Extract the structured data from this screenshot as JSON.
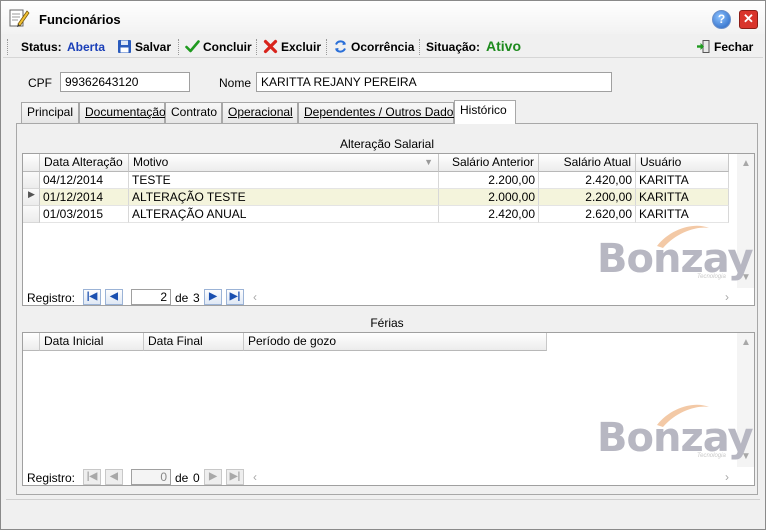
{
  "window": {
    "title": "Funcionários"
  },
  "toolbar": {
    "status_label": "Status:",
    "status_value": "Aberta",
    "save": "Salvar",
    "conclude": "Concluir",
    "delete": "Excluir",
    "occurrence": "Ocorrência",
    "situation_label": "Situação:",
    "situation_value": "Ativo",
    "close": "Fechar"
  },
  "form": {
    "cpf_label": "CPF",
    "cpf_value": "99362643120",
    "name_label": "Nome",
    "name_value": "KARITTA REJANY PEREIRA"
  },
  "tabs": [
    "Principal",
    "Documentação",
    "Contrato",
    "Operacional",
    "Dependentes / Outros Dados",
    "Histórico"
  ],
  "salary": {
    "title": "Alteração Salarial",
    "columns": [
      "Data Alteração",
      "Motivo",
      "Salário Anterior",
      "Salário Atual",
      "Usuário"
    ],
    "rows": [
      [
        "04/12/2014",
        "TESTE",
        "2.200,00",
        "2.420,00",
        "KARITTA"
      ],
      [
        "01/12/2014",
        "ALTERAÇÃO TESTE",
        "2.000,00",
        "2.200,00",
        "KARITTA"
      ],
      [
        "01/03/2015",
        "ALTERAÇÃO ANUAL",
        "2.420,00",
        "2.620,00",
        "KARITTA"
      ]
    ],
    "nav_label": "Registro:",
    "nav_current": "2",
    "nav_of": "de",
    "nav_total": "3"
  },
  "vacation": {
    "title": "Férias",
    "columns": [
      "Data Inicial",
      "Data Final",
      "Período de gozo"
    ],
    "nav_label": "Registro:",
    "nav_current": "0",
    "nav_of": "de",
    "nav_total": "0"
  },
  "logo": {
    "text": "Bonzay",
    "sub": "Tecnologia"
  },
  "colors": {
    "status_value": "#1a3fb8",
    "situation_value": "#1d8a1d",
    "selected_row": "#f4f4dc"
  }
}
